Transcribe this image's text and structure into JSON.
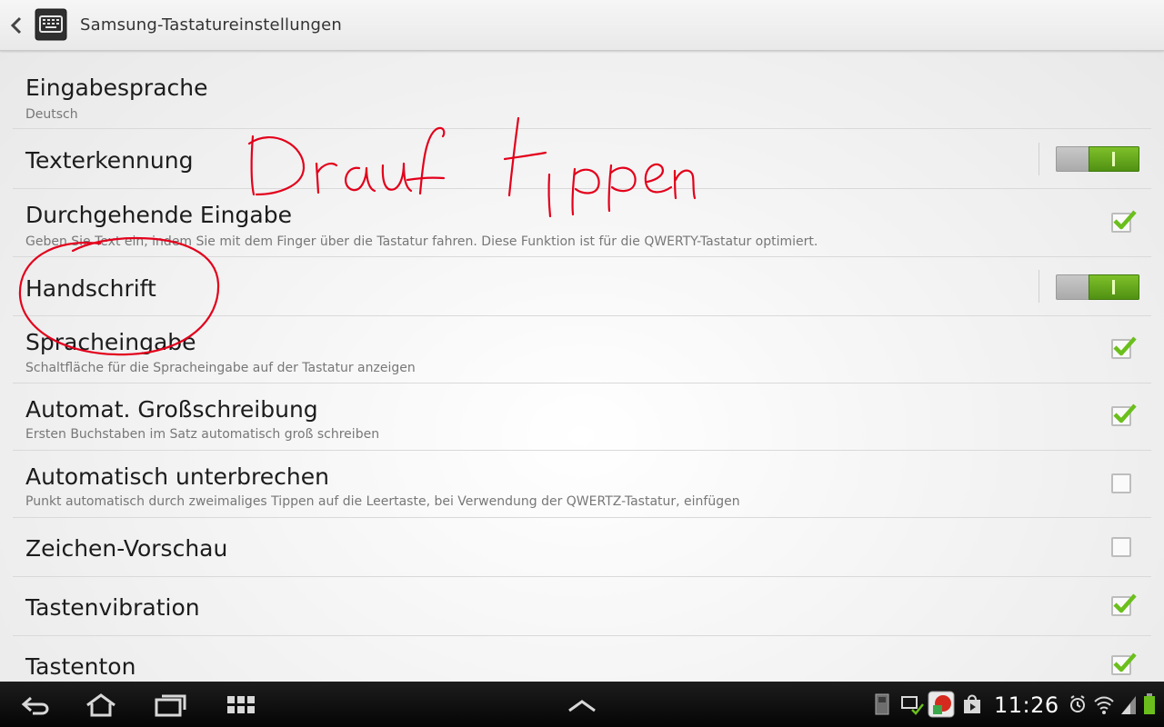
{
  "header": {
    "title": "Samsung-Tastatureinstellungen"
  },
  "annotation": {
    "scribble_text": "Drauf tippen",
    "color": "#e3001b"
  },
  "settings": [
    {
      "title": "Eingabesprache",
      "subtitle": "Deutsch",
      "control": "none"
    },
    {
      "title": "Texterkennung",
      "subtitle": "",
      "control": "toggle",
      "checked": true
    },
    {
      "title": "Durchgehende Eingabe",
      "subtitle": "Geben Sie Text ein, indem Sie mit dem Finger über die Tastatur fahren. Diese Funktion ist für die QWERTY-Tastatur optimiert.",
      "control": "checkbox",
      "checked": true
    },
    {
      "title": "Handschrift",
      "subtitle": "",
      "control": "toggle",
      "checked": true
    },
    {
      "title": "Spracheingabe",
      "subtitle": "Schaltfläche für die Spracheingabe auf der Tastatur anzeigen",
      "control": "checkbox",
      "checked": true
    },
    {
      "title": "Automat. Großschreibung",
      "subtitle": "Ersten Buchstaben im Satz automatisch groß schreiben",
      "control": "checkbox",
      "checked": true
    },
    {
      "title": "Automatisch unterbrechen",
      "subtitle": "Punkt automatisch durch zweimaliges Tippen auf die Leertaste, bei Verwendung der QWERTZ-Tastatur, einfügen",
      "control": "checkbox",
      "checked": false
    },
    {
      "title": "Zeichen-Vorschau",
      "subtitle": "",
      "control": "checkbox",
      "checked": false
    },
    {
      "title": "Tastenvibration",
      "subtitle": "",
      "control": "checkbox",
      "checked": true
    },
    {
      "title": "Tastenton",
      "subtitle": "",
      "control": "checkbox",
      "checked": true
    }
  ],
  "navbar": {
    "buttons": [
      "back-icon",
      "home-icon",
      "recent-apps-icon",
      "screenshot-grid-icon",
      "chevron-up-icon"
    ],
    "status": {
      "time": "11:26"
    }
  },
  "colors": {
    "toggle_on": "#6aaa1f",
    "check": "#6bbf1c",
    "navbar": "#0b0b0b"
  }
}
